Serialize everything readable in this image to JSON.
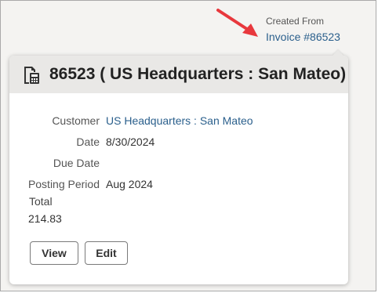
{
  "created_from": {
    "label": "Created From",
    "link_text": "Invoice #86523"
  },
  "popup": {
    "icon": "invoice-document-icon",
    "title": "86523 ( US Headquarters : San Mateo)",
    "fields": {
      "customer": {
        "label": "Customer",
        "value": "US Headquarters : San Mateo"
      },
      "date": {
        "label": "Date",
        "value": "8/30/2024"
      },
      "due_date": {
        "label": "Due Date",
        "value": ""
      },
      "posting_period": {
        "label": "Posting Period",
        "value": "Aug 2024"
      }
    },
    "total": {
      "label": "Total",
      "value": "214.83"
    },
    "buttons": {
      "view": "View",
      "edit": "Edit"
    }
  },
  "colors": {
    "arrow": "#e8383d",
    "link": "#2a5f8c",
    "header_bg": "#e9e8e6",
    "page_bg": "#f4f3f1"
  }
}
